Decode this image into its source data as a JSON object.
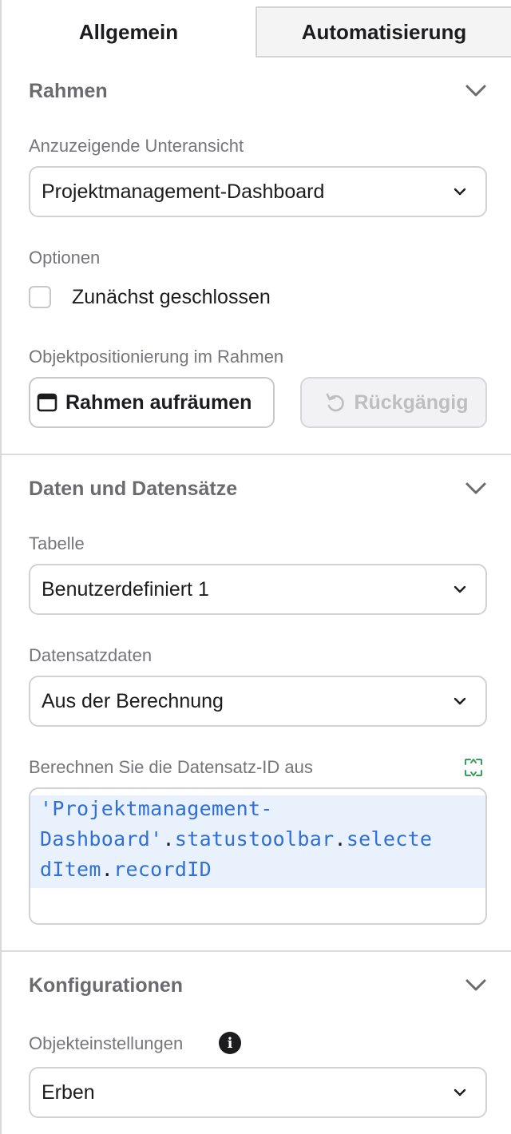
{
  "tabs": [
    {
      "label": "Allgemein",
      "active": true
    },
    {
      "label": "Automatisierung",
      "active": false
    }
  ],
  "frame_section": {
    "title": "Rahmen",
    "subview_label": "Anzuzeigende Unteransicht",
    "subview_value": "Projektmanagement-Dashboard",
    "options_label": "Optionen",
    "initially_closed_label": "Zunächst geschlossen",
    "initially_closed_checked": false,
    "positioning_label": "Objektpositionierung im Rahmen",
    "cleanup_button": "Rahmen aufräumen",
    "undo_button": "Rückgängig"
  },
  "data_section": {
    "title": "Daten und Datensätze",
    "table_label": "Tabelle",
    "table_value": "Benutzerdefiniert 1",
    "record_data_label": "Datensatzdaten",
    "record_data_value": "Aus der Berechnung",
    "calc_label": "Berechnen Sie die Datensatz-ID aus",
    "code_lines": {
      "line1": "'Projektmanagement-",
      "line2a": "Dashboard'",
      "line2b": "statustoolbar",
      "line2c": "selecte",
      "line3a": "dItem",
      "line3b": "recordID"
    }
  },
  "config_section": {
    "title": "Konfigurationen",
    "object_settings_label": "Objekteinstellungen",
    "object_settings_value": "Erben"
  },
  "colors": {
    "code_text": "#2f6fd6",
    "code_highlight": "#e8f1fc",
    "expand_icon": "#3a9d5d"
  },
  "icons": {
    "collapse": "chevron-down-icon",
    "dropdown": "chevron-down-icon",
    "cleanup": "window-icon",
    "undo": "undo-icon",
    "expand": "expand-icon",
    "info": "info-icon"
  }
}
